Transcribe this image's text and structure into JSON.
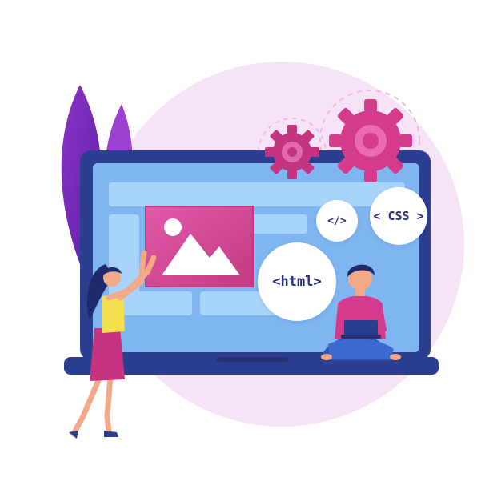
{
  "code_tags": {
    "html": "<html>",
    "tag": "</>",
    "css": "< CSS >"
  },
  "icons": {
    "picture": "image-placeholder-icon",
    "gears": "gear-icon",
    "laptop": "laptop-icon"
  },
  "colors": {
    "background_circle": "#f7e3f6",
    "laptop_frame": "#2c3e8f",
    "screen": "#7fb6f0",
    "screen_panel": "#a8d4fa",
    "accent_magenta": "#d43b8c",
    "leaf_purple": "#7d2bc1",
    "text_navy": "#2a2d7a"
  }
}
